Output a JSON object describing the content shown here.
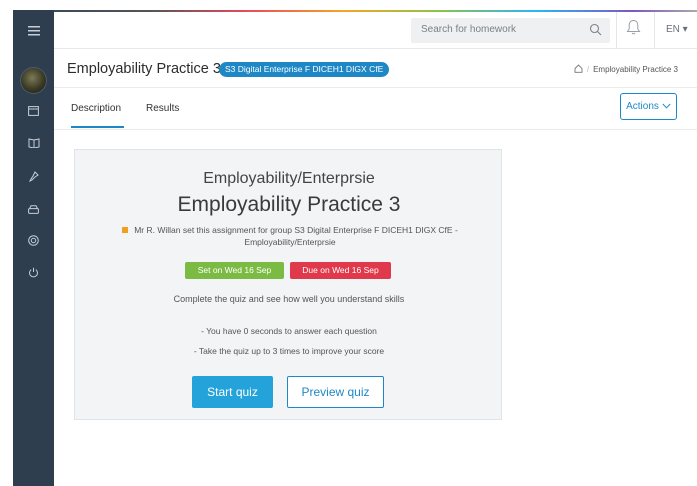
{
  "header": {
    "search_placeholder": "Search for homework",
    "language": "EN ▾"
  },
  "sidebar": {
    "items": [
      {
        "icon": "menu-icon"
      },
      {
        "icon": "avatar"
      },
      {
        "icon": "calendar-icon"
      },
      {
        "icon": "book-icon"
      },
      {
        "icon": "pin-icon"
      },
      {
        "icon": "drive-icon"
      },
      {
        "icon": "help-icon"
      },
      {
        "icon": "power-icon"
      }
    ]
  },
  "page": {
    "title": "Employability Practice 3",
    "class_badge": "S3 Digital Enterprise F DICEH1 DIGX CfE",
    "breadcrumb": {
      "separator": "/",
      "current": "Employability Practice 3"
    }
  },
  "tabs": [
    {
      "label": "Description",
      "active": true
    },
    {
      "label": "Results",
      "active": false
    }
  ],
  "actions_label": "Actions",
  "assignment": {
    "subject": "Employability/Enterprsie",
    "title": "Employability Practice 3",
    "set_by": "Mr R. Willan set this assignment for group S3 Digital Enterprise F DICEH1 DIGX CfE - Employability/Enterprsie",
    "set_on": "Set on Wed 16 Sep",
    "due_on": "Due on Wed 16 Sep",
    "instructions": "Complete the quiz and see how well you understand skills",
    "notes": [
      "- You have 0 seconds to answer each question",
      "- Take the quiz up to 3 times to improve your score"
    ],
    "start_label": "Start quiz",
    "preview_label": "Preview quiz"
  },
  "colors": {
    "accent": "#1e88c7",
    "sidebar": "#2f3e4f",
    "set_green": "#7cbb43",
    "due_red": "#e0394b",
    "start_button": "#23a3d9",
    "teacher_marker": "#f0a01e"
  }
}
